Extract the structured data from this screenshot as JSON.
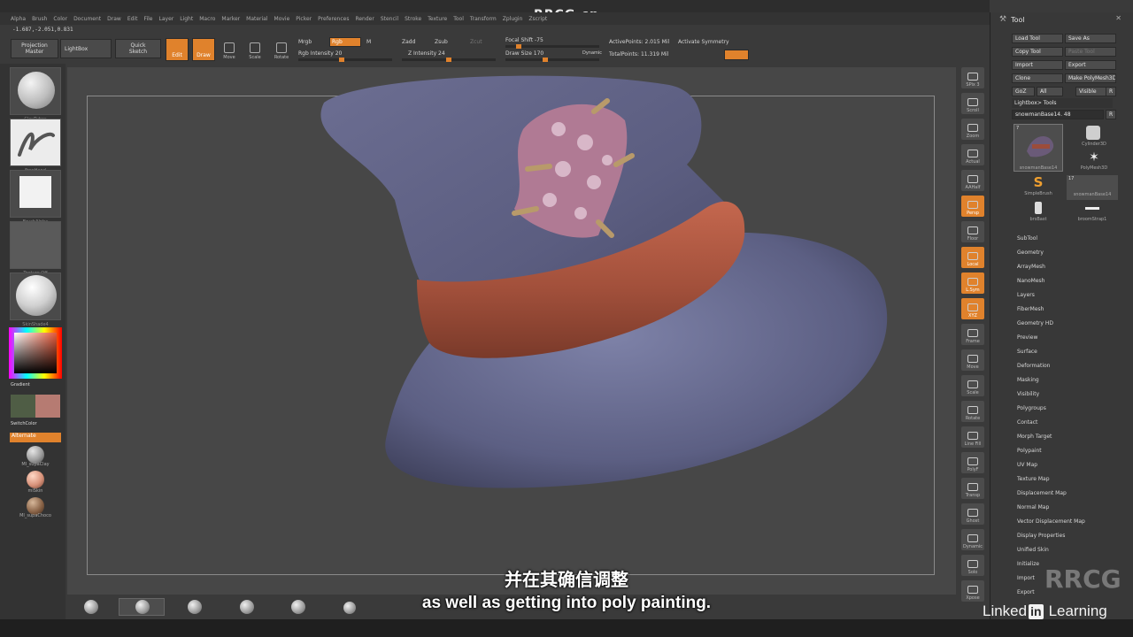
{
  "watermark": {
    "top": "RRCG.cn",
    "corner": "RRCG"
  },
  "menu": [
    "Alpha",
    "Brush",
    "Color",
    "Document",
    "Draw",
    "Edit",
    "File",
    "Layer",
    "Light",
    "Macro",
    "Marker",
    "Material",
    "Movie",
    "Picker",
    "Preferences",
    "Render",
    "Stencil",
    "Stroke",
    "Texture",
    "Tool",
    "Transform",
    "Zplugin",
    "Zscript"
  ],
  "coords": "-1.687,-2.051,0.831",
  "toolbar": {
    "projection_master": "Projection Master",
    "lightbox": "LightBox",
    "quick_sketch": "Quick Sketch",
    "edit": "Edit",
    "draw": "Draw",
    "move": "Move",
    "scale": "Scale",
    "rotate": "Rotate",
    "mrgb": "Mrgb",
    "rgb": "Rgb",
    "m": "M",
    "rgb_intensity": "Rgb Intensity 20",
    "zadd": "Zadd",
    "zsub": "Zsub",
    "zcut": "Zcut",
    "z_intensity": "Z Intensity 24",
    "focal_shift": "Focal Shift -75",
    "draw_size": "Draw Size 170",
    "dynamic": "Dynamic",
    "active_points": "ActivePoints: 2.015 Mil",
    "total_points": "TotalPoints: 11.319 Mil",
    "activate_symmetry": "Activate Symmetry"
  },
  "left_shelf": {
    "brush": "ClayTubes",
    "stroke": "FreeHand",
    "alpha": "BrushAlpha",
    "texture": "Texture Off",
    "material": "SkinShade4",
    "gradient": "Gradient",
    "switch_color": "SwitchColor",
    "alternate": "Alternate",
    "materials": [
      "MI_supaClay",
      "miSkin",
      "MI_supaChoco"
    ],
    "colors": {
      "accent": "#e0822c",
      "secondary": "#5a6a4a",
      "main": "#b67b72"
    }
  },
  "right_bar": [
    "SPix 3",
    "Scroll",
    "Zoom",
    "Actual",
    "AAHalf",
    "Persp",
    "Floor",
    "Local",
    "L.Sym",
    "XYZ",
    "Frame",
    "Move",
    "Scale",
    "Rotate",
    "Line Fill",
    "PolyF",
    "Transp",
    "Ghost",
    "Dynamic",
    "Solo",
    "Xpose"
  ],
  "tool_panel": {
    "title": "Tool",
    "buttons": [
      [
        "Load Tool",
        "Save As"
      ],
      [
        "Copy Tool",
        "Paste Tool"
      ],
      [
        "Import",
        "Export"
      ],
      [
        "Clone",
        "Make PolyMesh3D"
      ],
      [
        "GoZ",
        "All",
        "Visible",
        "R"
      ]
    ],
    "lightbox_tools": "Lightbox> Tools",
    "current_tool": "snowmanBase14. 48",
    "current_r": "R",
    "tools": [
      {
        "name": "snowmanBase14",
        "count": "7"
      },
      {
        "name": "Cylinder3D"
      },
      {
        "name": "PolyMesh3D"
      },
      {
        "name": "SimpleBrush"
      },
      {
        "name": "snowmanBase14",
        "count": "17"
      },
      {
        "name": "brsBast"
      },
      {
        "name": "broomStrap1"
      }
    ],
    "subpalettes": [
      "SubTool",
      "Geometry",
      "ArrayMesh",
      "NanoMesh",
      "Layers",
      "FiberMesh",
      "Geometry HD",
      "Preview",
      "Surface",
      "Deformation",
      "Masking",
      "Visibility",
      "Polygroups",
      "Contact",
      "Morph Target",
      "Polypaint",
      "UV Map",
      "Texture Map",
      "Displacement Map",
      "Normal Map",
      "Vector Displacement Map",
      "Display Properties",
      "Unified Skin",
      "Initialize",
      "Import",
      "Export"
    ]
  },
  "subtitles": {
    "cn": "并在其确信调整",
    "en": "as well as getting into poly painting."
  },
  "brand": {
    "linkedin": "Linked",
    "in": "in",
    "learning": "Learning"
  }
}
